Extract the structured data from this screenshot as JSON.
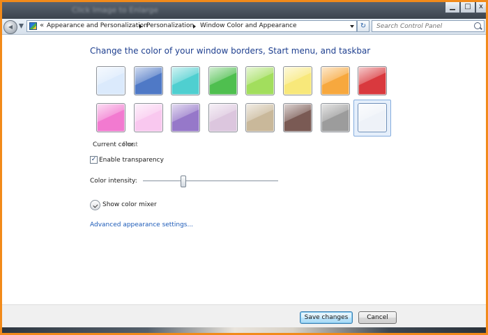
{
  "window": {
    "title": "Click Image to Enlarge",
    "minimize_glyph": "▁",
    "maximize_glyph": "□",
    "close_glyph": "x"
  },
  "address_bar": {
    "chevron": "«",
    "crumbs": [
      "Appearance and Personalization",
      "Personalization",
      "Window Color and Appearance"
    ],
    "search_placeholder": "Search Control Panel",
    "refresh_glyph": "↻"
  },
  "page": {
    "heading": "Change the color of your window borders, Start menu, and taskbar",
    "current_color_label": "Current color:",
    "current_color_value": "Frost",
    "transparency_label": "Enable transparency",
    "transparency_checked": true,
    "check_glyph": "✓",
    "intensity_label": "Color intensity:",
    "intensity_fraction": 0.3,
    "mixer_label": "Show color mixer",
    "advanced_link": "Advanced appearance settings..."
  },
  "swatches": [
    {
      "name": "sky",
      "color": "#dbeafc"
    },
    {
      "name": "twilight",
      "color": "#4f79c6"
    },
    {
      "name": "sea",
      "color": "#4fcfd0"
    },
    {
      "name": "leaf",
      "color": "#4fbf4f"
    },
    {
      "name": "lime",
      "color": "#a2de5d"
    },
    {
      "name": "lemon",
      "color": "#f8e87a"
    },
    {
      "name": "orange",
      "color": "#f7a83e"
    },
    {
      "name": "ruby",
      "color": "#d9393e"
    },
    {
      "name": "fuchsia",
      "color": "#f27ad0"
    },
    {
      "name": "blush",
      "color": "#f9c8ef"
    },
    {
      "name": "violet",
      "color": "#9678c9"
    },
    {
      "name": "lavender",
      "color": "#dcc6de"
    },
    {
      "name": "taupe",
      "color": "#c9b89a"
    },
    {
      "name": "chocolate",
      "color": "#7a5a54"
    },
    {
      "name": "slate",
      "color": "#9c9c9c"
    },
    {
      "name": "frost",
      "color": "#eef2f8"
    }
  ],
  "selected_swatch": 15,
  "footer": {
    "save_label": "Save changes",
    "cancel_label": "Cancel"
  }
}
